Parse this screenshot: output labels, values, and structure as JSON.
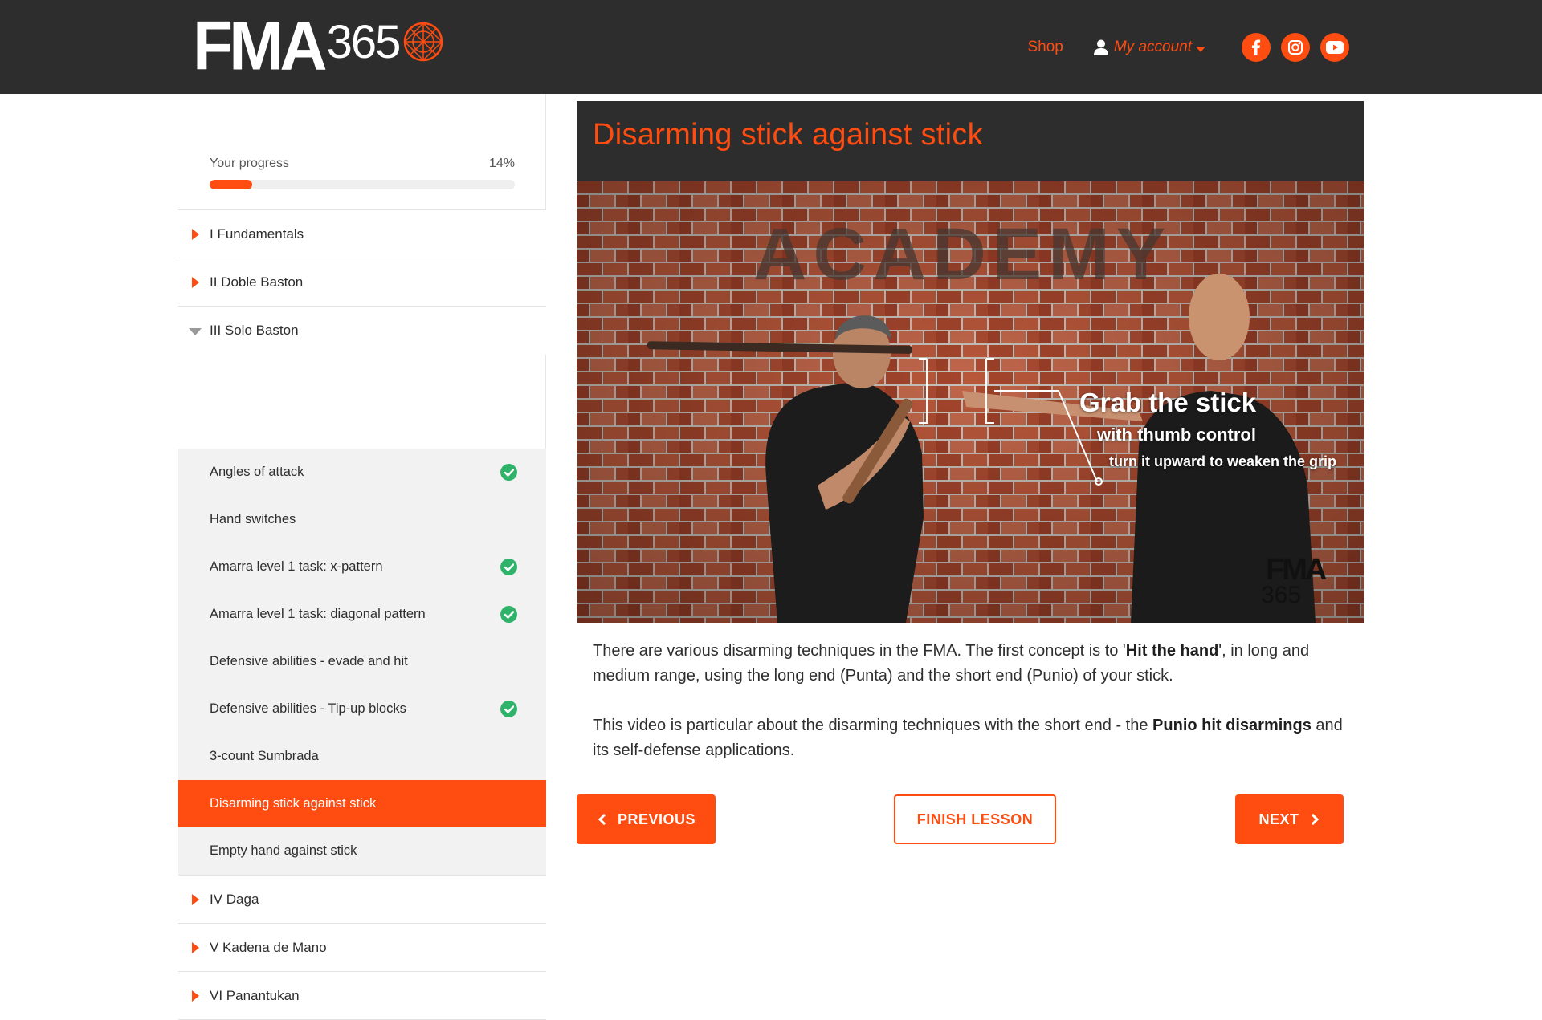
{
  "header": {
    "logo_main": "FMA",
    "logo_num": "365",
    "shop_label": "Shop",
    "account_label": "My account",
    "social": [
      "facebook-icon",
      "instagram-icon",
      "youtube-icon"
    ],
    "accent_color": "#ff4c10",
    "bg_color": "#2d2d2d"
  },
  "sidebar": {
    "progress_label": "Your progress",
    "progress_text": "14%",
    "progress_value": 0.14,
    "sections_before": [
      {
        "label": "I Fundamentals",
        "expanded": false
      },
      {
        "label": "II Doble Baston",
        "expanded": false
      },
      {
        "label": "III Solo Baston",
        "expanded": true
      }
    ],
    "lessons": [
      {
        "label": "Angles of attack",
        "completed": true,
        "active": false
      },
      {
        "label": "Hand switches",
        "completed": false,
        "active": false
      },
      {
        "label": "Amarra level 1 task: x-pattern",
        "completed": true,
        "active": false
      },
      {
        "label": "Amarra level 1 task: diagonal pattern",
        "completed": true,
        "active": false
      },
      {
        "label": "Defensive abilities - evade and hit",
        "completed": false,
        "active": false
      },
      {
        "label": "Defensive abilities - Tip-up blocks",
        "completed": true,
        "active": false
      },
      {
        "label": "3-count Sumbrada",
        "completed": false,
        "active": false
      },
      {
        "label": "Disarming stick against stick",
        "completed": false,
        "active": true
      },
      {
        "label": "Empty hand against stick",
        "completed": false,
        "active": false
      }
    ],
    "sections_after": [
      {
        "label": "IV Daga",
        "expanded": false
      },
      {
        "label": "V Kadena de Mano",
        "expanded": false
      },
      {
        "label": "VI Panantukan",
        "expanded": false
      }
    ]
  },
  "main": {
    "title": "Disarming stick against stick",
    "video": {
      "wall_text": "ACADEMY",
      "caption_1": "Grab the stick",
      "caption_2": "with thumb control",
      "caption_3": "turn it upward to weaken the grip",
      "watermark_main": "FMA",
      "watermark_num": "365"
    },
    "desc_p1_a": "There are various disarming techniques in the FMA. The first concept is to '",
    "desc_p1_b": "Hit the hand",
    "desc_p1_c": "', in long and medium range, using the long end (Punta) and the short end (Punio) of your stick.",
    "desc_p2_a": "This video is particular about the disarming techniques with the short end - the ",
    "desc_p2_b": "Punio hit disarmings",
    "desc_p2_c": " and its self-defense applications.",
    "prev_label": "PREVIOUS",
    "finish_label": "FINISH LESSON",
    "next_label": "NEXT"
  }
}
